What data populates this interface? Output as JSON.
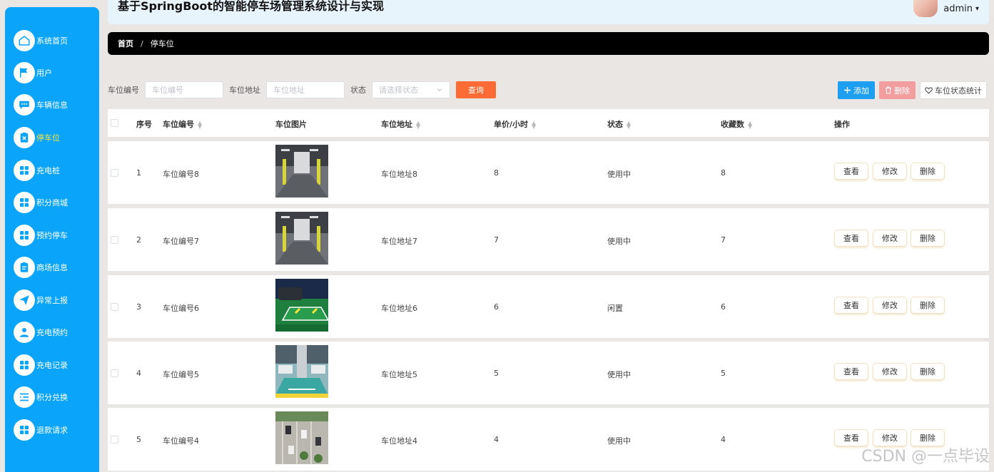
{
  "app": {
    "title": "基于SpringBoot的智能停车场管理系统设计与实现"
  },
  "user": {
    "name": "admin",
    "caret": "▾"
  },
  "sidebar": {
    "items": [
      {
        "label": "系统首页",
        "icon": "home-icon"
      },
      {
        "label": "用户",
        "icon": "flag-icon"
      },
      {
        "label": "车辆信息",
        "icon": "chat-icon"
      },
      {
        "label": "停车位",
        "icon": "clipboard-x-icon",
        "active": true
      },
      {
        "label": "充电桩",
        "icon": "grid-icon"
      },
      {
        "label": "积分商城",
        "icon": "grid-icon"
      },
      {
        "label": "预约停车",
        "icon": "grid-icon"
      },
      {
        "label": "商场信息",
        "icon": "clipboard-icon"
      },
      {
        "label": "异常上报",
        "icon": "paper-plane-icon"
      },
      {
        "label": "充电预约",
        "icon": "user-icon"
      },
      {
        "label": "充电记录",
        "icon": "grid-icon"
      },
      {
        "label": "积分兑换",
        "icon": "list-icon"
      },
      {
        "label": "退款请求",
        "icon": "grid-icon"
      }
    ]
  },
  "breadcrumb": {
    "home": "首页",
    "separator": "/",
    "current": "停车位"
  },
  "search": {
    "code_label": "车位编号",
    "code_placeholder": "车位编号",
    "addr_label": "车位地址",
    "addr_placeholder": "车位地址",
    "status_label": "状态",
    "status_placeholder": "请选择状态",
    "query_button": "查询"
  },
  "actions": {
    "add": "添加",
    "delete": "删除",
    "stats": "车位状态统计"
  },
  "table": {
    "headers": {
      "index": "序号",
      "code": "车位编号",
      "image": "车位图片",
      "address": "车位地址",
      "price": "单价/小时",
      "status": "状态",
      "favorites": "收藏数",
      "ops": "操作"
    },
    "rows": [
      {
        "index": "1",
        "code": "车位编号8",
        "address": "车位地址8",
        "price": "8",
        "status": "使用中",
        "favorites": "8",
        "img": "garage"
      },
      {
        "index": "2",
        "code": "车位编号7",
        "address": "车位地址7",
        "price": "7",
        "status": "使用中",
        "favorites": "7",
        "img": "garage"
      },
      {
        "index": "3",
        "code": "车位编号6",
        "address": "车位地址6",
        "price": "6",
        "status": "闲置",
        "favorites": "6",
        "img": "green"
      },
      {
        "index": "4",
        "code": "车位编号5",
        "address": "车位地址5",
        "price": "5",
        "status": "使用中",
        "favorites": "5",
        "img": "mall"
      },
      {
        "index": "5",
        "code": "车位编号4",
        "address": "车位地址4",
        "price": "4",
        "status": "使用中",
        "favorites": "4",
        "img": "aerial"
      }
    ],
    "row_ops": {
      "view": "查看",
      "edit": "修改",
      "delete": "删除"
    }
  },
  "watermark": "CSDN @一点毕设",
  "colors": {
    "sidebar": "#0aa5fb",
    "active": "#fde33a",
    "query": "#fe6b35",
    "add": "#1e9ff2",
    "delete": "#f39e9e"
  }
}
